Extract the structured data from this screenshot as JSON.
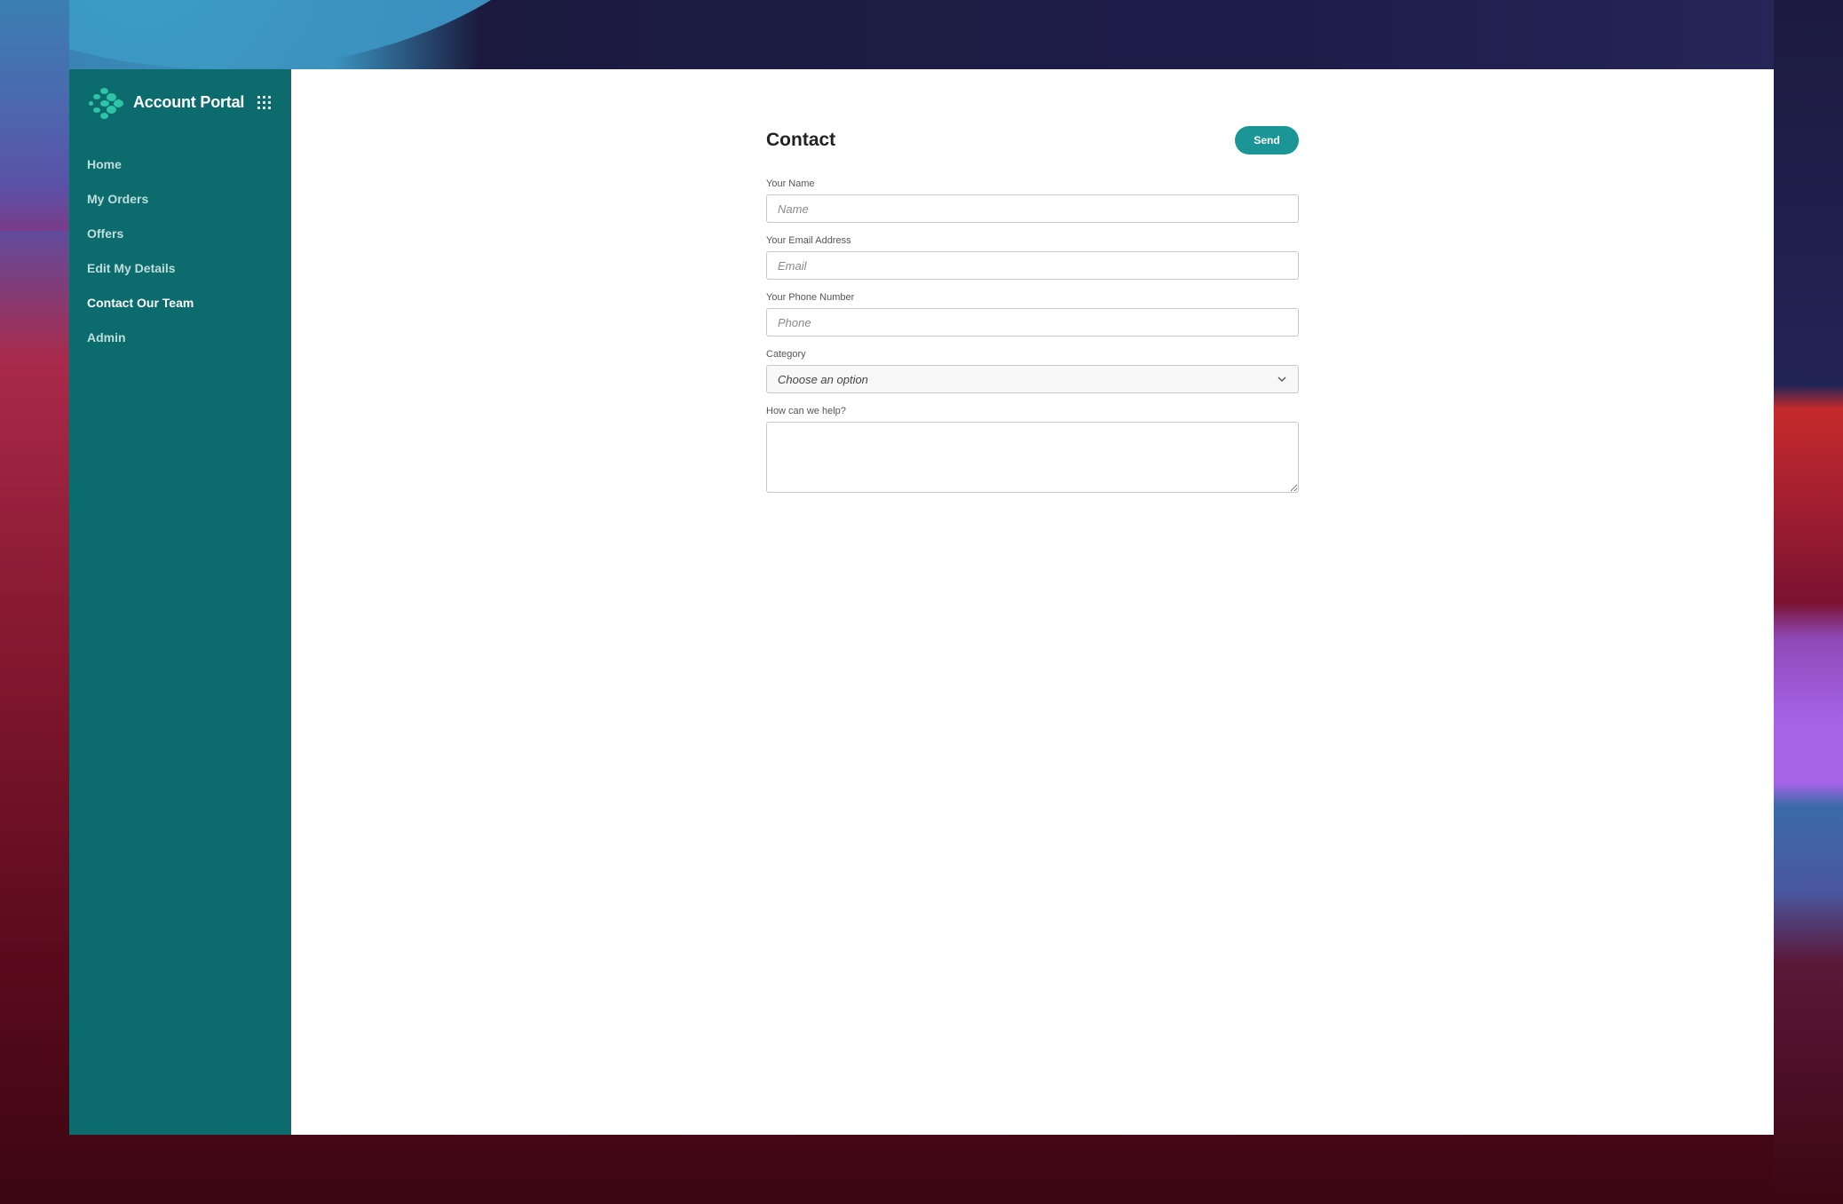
{
  "app": {
    "title": "Account Portal"
  },
  "sidebar": {
    "items": [
      {
        "label": "Home",
        "active": false
      },
      {
        "label": "My Orders",
        "active": false
      },
      {
        "label": "Offers",
        "active": false
      },
      {
        "label": "Edit My Details",
        "active": false
      },
      {
        "label": "Contact Our Team",
        "active": true
      },
      {
        "label": "Admin",
        "active": false
      }
    ]
  },
  "page": {
    "title": "Contact",
    "send_label": "Send"
  },
  "form": {
    "name": {
      "label": "Your Name",
      "placeholder": "Name",
      "value": ""
    },
    "email": {
      "label": "Your Email Address",
      "placeholder": "Email",
      "value": ""
    },
    "phone": {
      "label": "Your Phone Number",
      "placeholder": "Phone",
      "value": ""
    },
    "category": {
      "label": "Category",
      "selected": "Choose an option"
    },
    "message": {
      "label": "How can we help?",
      "value": ""
    }
  },
  "colors": {
    "sidebar_bg": "#0b6b6d",
    "accent": "#1c9596",
    "logo": "#2ec4a6"
  },
  "icons": {
    "logo": "dots-diamond-logo",
    "apps": "grid-icon",
    "select": "chevron-down-icon"
  }
}
